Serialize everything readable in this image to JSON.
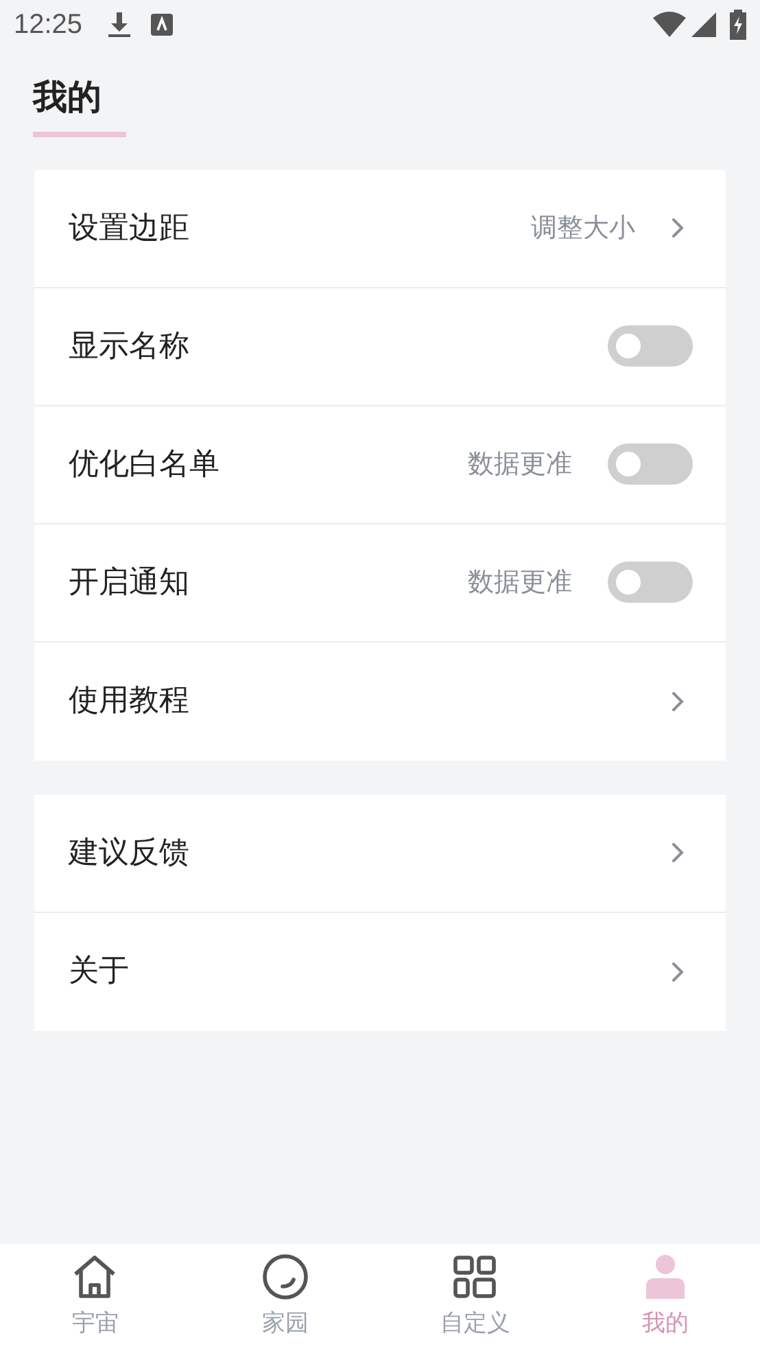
{
  "status_bar": {
    "time": "12:25"
  },
  "header": {
    "title": "我的"
  },
  "groups": [
    {
      "rows": [
        {
          "kind": "link",
          "label": "设置边距",
          "detail": "调整大小"
        },
        {
          "kind": "toggle",
          "label": "显示名称",
          "on": false
        },
        {
          "kind": "toggle",
          "label": "优化白名单",
          "detail": "数据更准",
          "on": false
        },
        {
          "kind": "toggle",
          "label": "开启通知",
          "detail": "数据更准",
          "on": false
        },
        {
          "kind": "link",
          "label": "使用教程"
        }
      ]
    },
    {
      "rows": [
        {
          "kind": "link",
          "label": "建议反馈"
        },
        {
          "kind": "link",
          "label": "关于"
        }
      ]
    }
  ],
  "bottom_nav": [
    {
      "kind": "home",
      "label": "宇宙",
      "selected": false
    },
    {
      "kind": "circle",
      "label": "家园",
      "selected": false
    },
    {
      "kind": "grid",
      "label": "自定义",
      "selected": false
    },
    {
      "kind": "person",
      "label": "我的",
      "selected": true
    }
  ]
}
